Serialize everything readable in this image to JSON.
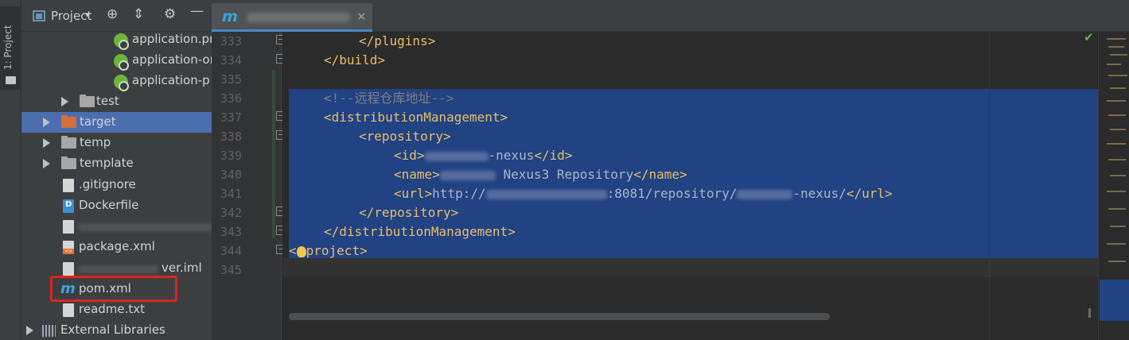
{
  "left_stripe": {
    "tab_label": "1: Project"
  },
  "project_panel": {
    "title": "Project",
    "tree": [
      {
        "label": "application.pr",
        "icon": "spring-icon"
      },
      {
        "label": "application-or",
        "icon": "spring-icon"
      },
      {
        "label": "application-p",
        "icon": "spring-icon"
      },
      {
        "label": "test",
        "icon": "folder-icon",
        "collapsed": true
      },
      {
        "label": "target",
        "icon": "folder-orange-icon",
        "collapsed": true,
        "selected": true
      },
      {
        "label": "temp",
        "icon": "folder-icon",
        "collapsed": true
      },
      {
        "label": "template",
        "icon": "folder-icon",
        "collapsed": true
      },
      {
        "label": ".gitignore",
        "icon": "file-icon"
      },
      {
        "label": "Dockerfile",
        "icon": "docker-file-icon"
      },
      {
        "label": "",
        "icon": "file-icon"
      },
      {
        "label": "package.xml",
        "icon": "xml-file-icon"
      },
      {
        "label": "ver.iml",
        "icon": "file-icon"
      },
      {
        "label": "pom.xml",
        "icon": "maven-icon"
      },
      {
        "label": "readme.txt",
        "icon": "file-icon"
      },
      {
        "label": "External Libraries",
        "icon": "libraries-icon",
        "collapsed": true
      }
    ]
  },
  "editor": {
    "tab_icon": "maven-icon",
    "line_numbers": [
      "333",
      "334",
      "335",
      "336",
      "337",
      "338",
      "339",
      "340",
      "341",
      "342",
      "343",
      "344",
      "345"
    ],
    "lines": {
      "l333_tag": "</plugins>",
      "l334_tag": "</build>",
      "l336_comment": "<!--远程仓库地址-->",
      "l337_tag": "<distributionManagement>",
      "l338_tag": "<repository>",
      "l339_open": "<id>",
      "l339_text": "-nexus",
      "l339_close": "</id>",
      "l340_open": "<name>",
      "l340_text": "Nexus3 Repository",
      "l340_close": "</name>",
      "l341_open": "<url>",
      "l341_text1": "http://",
      "l341_text2": ":8081/repository/",
      "l341_text3": "-nexus/",
      "l341_close": "</url>",
      "l342_tag": "</repository>",
      "l343_tag": "</distributionManagement>",
      "l344_open": "<",
      "l344_rest": "project>"
    }
  },
  "colors": {
    "selection": "#214283",
    "tag": "#e8bf6a",
    "comment": "#808080",
    "selected_tree_row": "#4b6eaf",
    "highlight_box": "#e0221c"
  }
}
